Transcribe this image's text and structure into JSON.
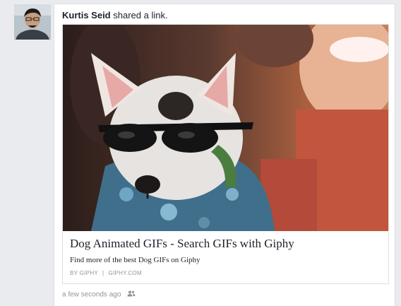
{
  "post": {
    "author": "Kurtis Seid",
    "action": "shared a link.",
    "timestamp": "a few seconds ago",
    "audience_icon": "friends-icon"
  },
  "link_card": {
    "title": "Dog Animated GIFs - Search GIFs with Giphy",
    "description": "Find more of the best Dog GIFs on Giphy",
    "source_by": "BY GIPHY",
    "source_domain": "GIPHY.COM"
  },
  "colors": {
    "page_background": "#e9ebee",
    "card_border": "#dddfe2",
    "text_primary": "#1d2129",
    "text_secondary": "#90949c"
  }
}
